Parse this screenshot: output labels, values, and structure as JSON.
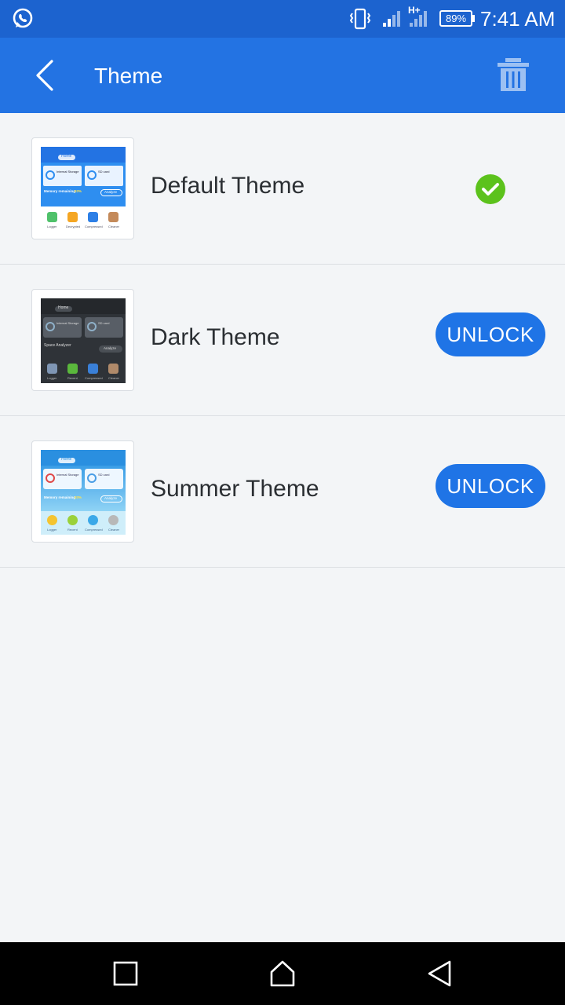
{
  "status_bar": {
    "time": "7:41 AM",
    "battery": "89%",
    "network": "H+",
    "icons": [
      "whatsapp-icon",
      "vibrate-icon",
      "signal-icon",
      "battery-icon"
    ]
  },
  "app_bar": {
    "title": "Theme",
    "back_icon": "back-arrow-icon",
    "delete_icon": "trash-icon"
  },
  "themes": [
    {
      "name": "Default Theme",
      "status": "selected",
      "status_icon": "check-circle-icon"
    },
    {
      "name": "Dark Theme",
      "action_label": "UNLOCK"
    },
    {
      "name": "Summer Theme",
      "action_label": "UNLOCK"
    }
  ],
  "thumbnails": {
    "home_label": "Home",
    "internal_label": "Internal Storage",
    "sd_label": "SD card",
    "memory_label": "Memory remaining",
    "memory_percent": "93%",
    "space_label": "Space Analyzer",
    "analyze_label": "Analyze",
    "apps": [
      "Logger",
      "Decrypted",
      "Compressed",
      "Cleaner"
    ],
    "apps_dark": [
      "Logger",
      "Recent",
      "Compressed",
      "Cleaner"
    ]
  },
  "nav_bar": {
    "icons": [
      "recents-icon",
      "home-icon",
      "back-icon"
    ]
  },
  "colors": {
    "status_bar": "#1c63cf",
    "app_bar": "#2373e3",
    "accent": "#1f74e6",
    "check": "#5cc21c",
    "background": "#f3f5f7"
  }
}
